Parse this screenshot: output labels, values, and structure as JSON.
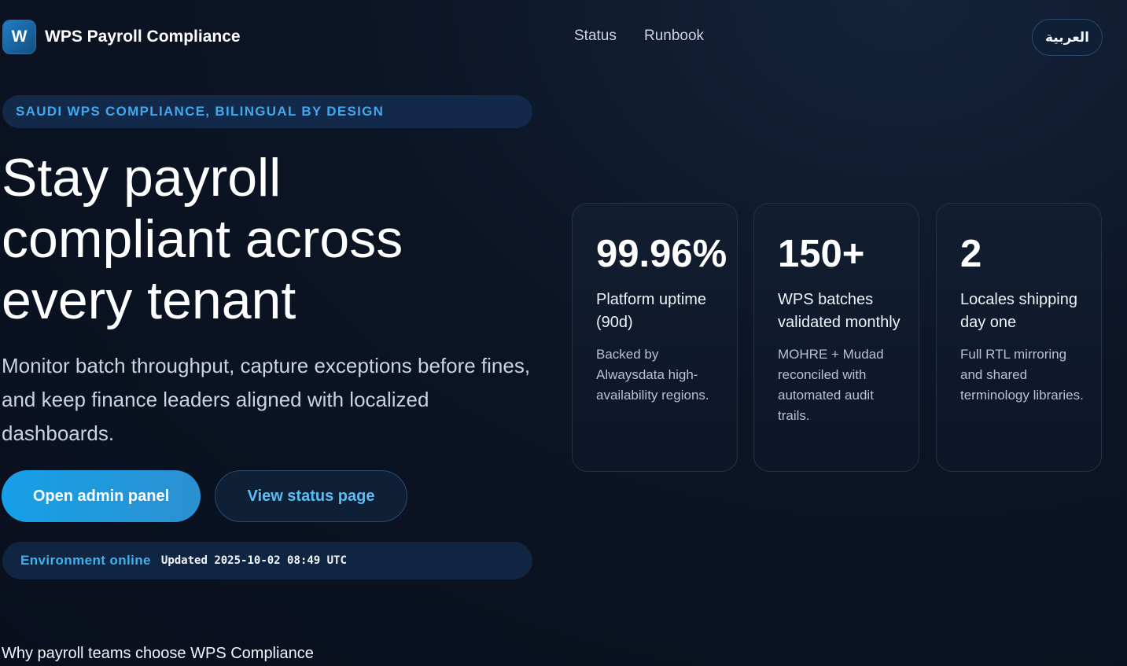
{
  "header": {
    "logo_letter": "W",
    "brand": "WPS Payroll Compliance",
    "nav": [
      {
        "label": "Status"
      },
      {
        "label": "Runbook"
      }
    ],
    "language_toggle": "العربية"
  },
  "hero": {
    "eyebrow": "SAUDI WPS COMPLIANCE, BILINGUAL BY DESIGN",
    "title_lines": [
      "Stay payroll",
      "compliant across",
      "every tenant"
    ],
    "subtitle": "Monitor batch throughput, capture exceptions before fines, and keep finance leaders aligned with localized dashboards.",
    "primary_button": "Open admin panel",
    "secondary_button": "View status page",
    "environment": {
      "status": "Environment online",
      "updated": "Updated 2025-10-02 08:49 UTC"
    }
  },
  "stats": [
    {
      "value": "99.96%",
      "label": "Platform uptime (90d)",
      "description": "Backed by Alwaysdata high-availability regions."
    },
    {
      "value": "150+",
      "label": "WPS batches validated monthly",
      "description": "MOHRE + Mudad reconciled with automated audit trails."
    },
    {
      "value": "2",
      "label": "Locales shipping day one",
      "description": "Full RTL mirroring and shared terminology libraries."
    }
  ],
  "next_section_heading": "Why payroll teams choose WPS Compliance",
  "colors": {
    "background": "#0b1222",
    "accent": "#16a0e8",
    "accent_text": "#41a8ee",
    "card_border": "#233246"
  }
}
